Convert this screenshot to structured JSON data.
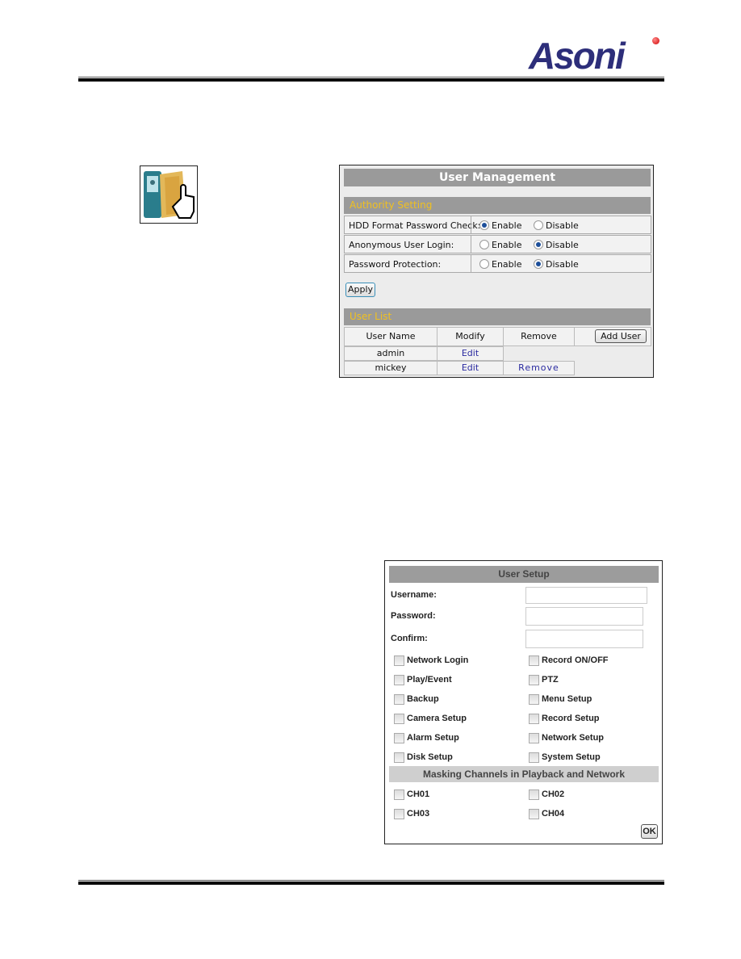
{
  "brand": {
    "logo_text": "Asoni"
  },
  "icon": {
    "name": "user-management-folder-icon"
  },
  "user_management": {
    "title": "User Management",
    "authority_section": "Authority Setting",
    "settings": [
      {
        "label": "HDD Format Password Check:",
        "enable": "Enable",
        "disable": "Disable",
        "selected": "Enable"
      },
      {
        "label": "Anonymous User Login:",
        "enable": "Enable",
        "disable": "Disable",
        "selected": "Disable"
      },
      {
        "label": "Password Protection:",
        "enable": "Enable",
        "disable": "Disable",
        "selected": "Disable"
      }
    ],
    "apply_label": "Apply",
    "user_list_section": "User List",
    "columns": [
      "User Name",
      "Modify",
      "Remove"
    ],
    "add_user_label": "Add User",
    "users": [
      {
        "name": "admin",
        "modify": "Edit",
        "remove": ""
      },
      {
        "name": "mickey",
        "modify": "Edit",
        "remove": "Remove"
      }
    ]
  },
  "user_setup": {
    "title": "User Setup",
    "username_label": "Username:",
    "username_value": "",
    "password_label": "Password:",
    "password_value": "",
    "confirm_label": "Confirm:",
    "confirm_value": "",
    "permissions": [
      [
        "Network Login",
        "Record ON/OFF"
      ],
      [
        "Play/Event",
        "PTZ"
      ],
      [
        "Backup",
        "Menu Setup"
      ],
      [
        "Camera Setup",
        "Record Setup"
      ],
      [
        "Alarm Setup",
        "Network Setup"
      ],
      [
        "Disk Setup",
        "System Setup"
      ]
    ],
    "masking_title": "Masking Channels in Playback and Network",
    "channels": [
      [
        "CH01",
        "CH02"
      ],
      [
        "CH03",
        "CH04"
      ]
    ],
    "ok_label": "OK"
  },
  "colors": {
    "section_text": "#f0c020",
    "header_bar": "#9a9a9a",
    "link": "#2a2aa0",
    "logo": "#2d2e7a"
  }
}
